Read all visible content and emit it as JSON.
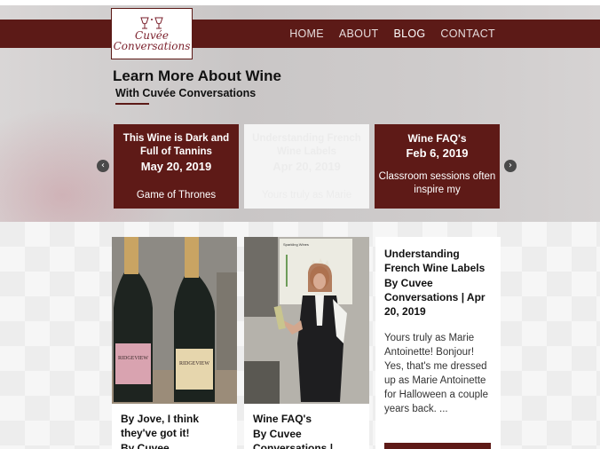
{
  "brand": {
    "logo_line1": "Cuvée",
    "logo_line2": "Conversations"
  },
  "nav": {
    "items": [
      "HOME",
      "ABOUT",
      "BLOG",
      "CONTACT"
    ],
    "active": "BLOG"
  },
  "hero": {
    "title": "Learn More About Wine",
    "subtitle": "With Cuvée Conversations"
  },
  "carousel": {
    "prev_label": "‹",
    "next_label": "›",
    "slides": [
      {
        "title": "This Wine is Dark and Full of Tannins",
        "date": "May 20, 2019",
        "excerpt": "Game of Thrones"
      },
      {
        "title": "Understanding French Wine Labels",
        "date": "Apr 20, 2019",
        "excerpt": "Yours truly as Marie"
      },
      {
        "title": "Wine FAQ's",
        "date": "Feb 6, 2019",
        "excerpt": "Classroom sessions often inspire my"
      }
    ]
  },
  "posts": [
    {
      "title": "By Jove, I think they've got it!",
      "byline": "By Cuvee"
    },
    {
      "title": "Wine FAQ's",
      "byline": "By Cuvee Conversations |"
    },
    {
      "title": "Understanding French Wine Labels",
      "byline": "By Cuvee Conversations | Apr 20, 2019",
      "excerpt": "Yours truly as Marie Antoinette! Bonjour! Yes, that's me dressed up as Marie Antoinette for Halloween a couple years back. ..."
    }
  ],
  "photo_text": {
    "bottle_label": "RIDGEVIEW",
    "screen_label": "Sparkling Wines"
  },
  "colors": {
    "burgundy": "#5c1a17",
    "hero_bg": "#cdcaca",
    "pattern_bg": "#ededed"
  }
}
